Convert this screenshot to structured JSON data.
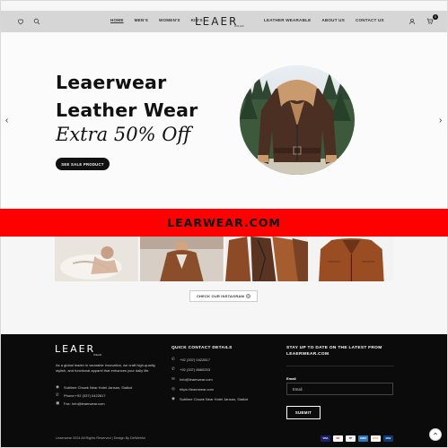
{
  "header": {
    "nav_left": [
      "HOME",
      "MEN'S",
      "WOMEN'S",
      "KID'S"
    ],
    "nav_right": [
      "LEATHER WEARABLE",
      "ABOUT US",
      "CONTACT US"
    ],
    "logo_text": "LEAER",
    "logo_sub": "WEAR",
    "cart_count": "0"
  },
  "hero": {
    "line1": "Leaerwear",
    "line2": "Leather Wear",
    "line3": "Extra 50% Off",
    "button": "SEE SALE PRODUCT",
    "prev": "‹",
    "next": "›"
  },
  "banner": {
    "text": "LEARWEAR.COM"
  },
  "gallery": {
    "button": "CHECK OUR INSTAGRAM"
  },
  "footer": {
    "logo_text": "LEAER",
    "logo_sub": "WEAR",
    "description": "As a global leader in wearable innovation, we craft high-quality, stylish, and functional apparel that enhances your daily life.",
    "address": "Sublime Chowk Near Hotel Jansan, Sialkot",
    "phone": "Phone:+92 (337) 0422817",
    "fax": "Fax: Info@leaerwear.com",
    "quick_title": "QUICK CONTACT DETAILS",
    "quick": [
      "+92 (337) 0422817",
      "+92 (337) 8660253",
      "Info@leaerwear.com",
      "https://leaerwear.com",
      "Sublime Chowk Near Hotel Jansan, Sialkot"
    ],
    "newsletter_title_1": "STAY UP TO DATE ON THE LATEST FROM",
    "newsletter_title_2": "LEAERWEAR.COM",
    "email_label": "Email",
    "email_placeholder": "Email",
    "submit": "SUBMIT",
    "copyright": "Leaerwear 2024 All Rights Reserved | Design By DeWebful"
  },
  "payments": [
    "VISA",
    "MC",
    "PP",
    "AMEX",
    "DISC",
    "MAE"
  ],
  "colors": {
    "banner": "#ff0000",
    "footer": "#0b0b0b",
    "header": "#d6d6d6"
  }
}
